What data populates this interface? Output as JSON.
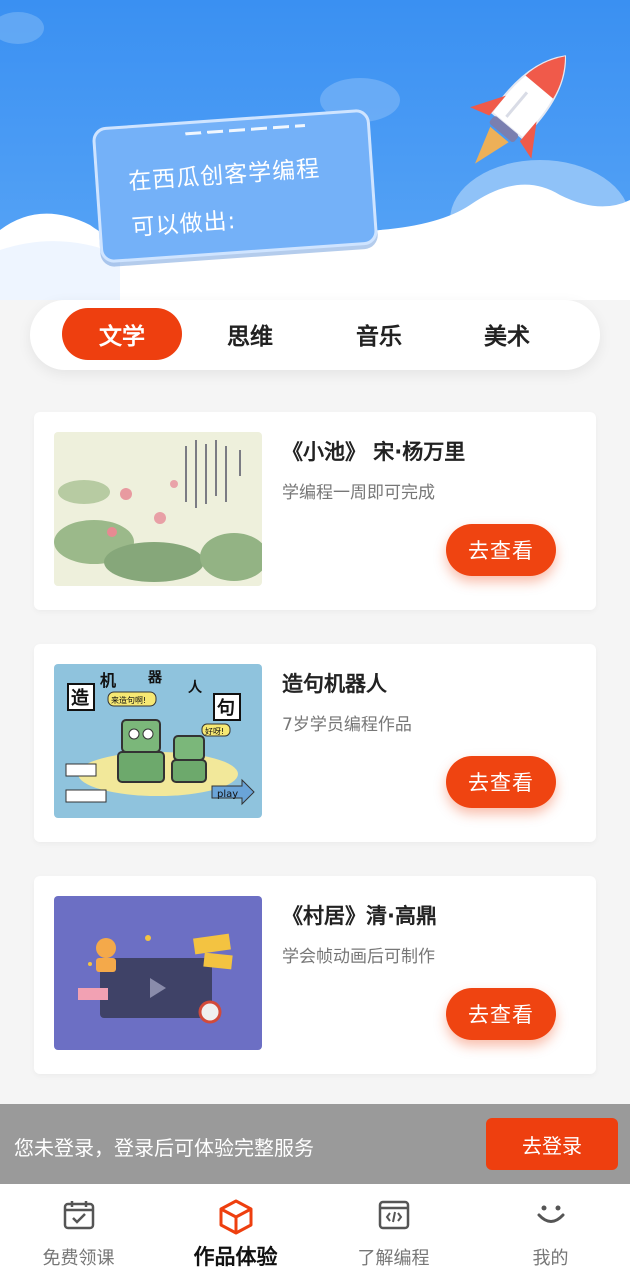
{
  "hero": {
    "line1": "在西瓜创客学编程",
    "line2": "可以做出:"
  },
  "tabs": [
    {
      "label": "文学",
      "active": true
    },
    {
      "label": "思维",
      "active": false
    },
    {
      "label": "音乐",
      "active": false
    },
    {
      "label": "美术",
      "active": false
    }
  ],
  "cards": [
    {
      "title": "《小池》 宋·杨万里",
      "subtitle": "学编程一周即可完成",
      "button": "去查看",
      "thumb_icon": "lotus-painting-image"
    },
    {
      "title": "造句机器人",
      "subtitle": "7岁学员编程作品",
      "button": "去查看",
      "thumb_icon": "robot-illustration-image",
      "thumb_texts": {
        "a": "机",
        "b": "器",
        "c": "人",
        "d": "造",
        "e": "句",
        "f": "来造句啊!",
        "g": "好呀!",
        "h": "play"
      }
    },
    {
      "title": "《村居》清·高鼎",
      "subtitle": "学会帧动画后可制作",
      "button": "去查看",
      "thumb_icon": "video-player-illustration-image"
    }
  ],
  "login_bar": {
    "text": "您未登录，登录后可体验完整服务",
    "button": "去登录"
  },
  "bottom_nav": [
    {
      "label": "免费领课",
      "icon": "calendar-check-icon",
      "active": false
    },
    {
      "label": "作品体验",
      "icon": "cube-icon",
      "active": true
    },
    {
      "label": "了解编程",
      "icon": "code-window-icon",
      "active": false
    },
    {
      "label": "我的",
      "icon": "smiley-icon",
      "active": false
    }
  ],
  "colors": {
    "accent": "#ee3f0f",
    "hero_blue": "#3a90f2",
    "login_bar": "#9a9a9a"
  }
}
